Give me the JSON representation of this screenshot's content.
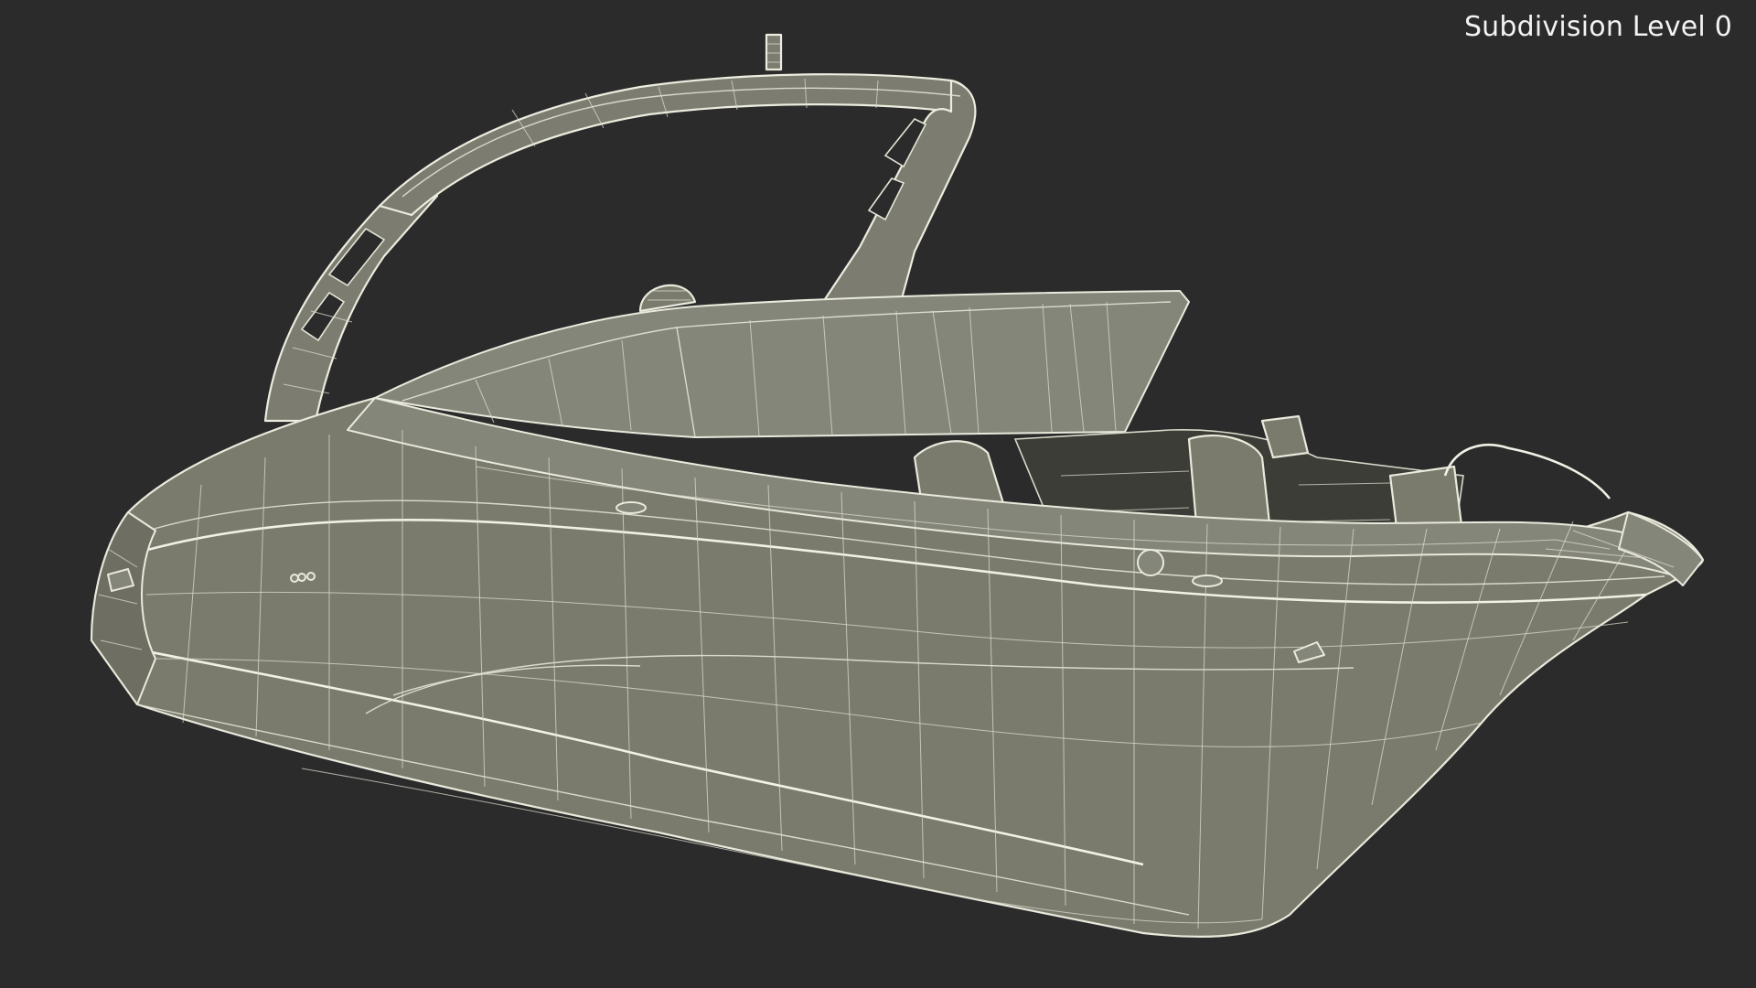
{
  "overlay": {
    "label": "Subdivision Level 0"
  },
  "viewport": {
    "background_color": "#2b2b2b",
    "model_fill_color": "#7a7b6d",
    "wire_color": "#e9e9dc",
    "subject": "wireframe-boat-model"
  }
}
